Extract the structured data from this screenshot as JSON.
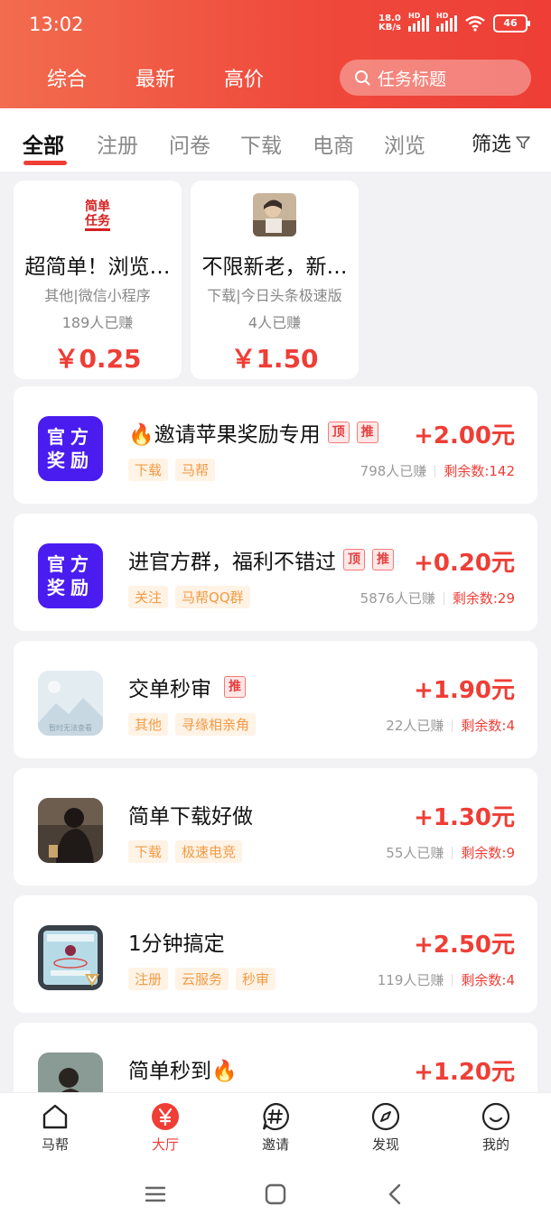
{
  "status": {
    "time": "13:02",
    "net_speed_top": "18.0",
    "net_speed_bottom": "KB/s",
    "hd": "HD",
    "battery": "46"
  },
  "header": {
    "tabs": [
      "综合",
      "最新",
      "高价"
    ],
    "search_placeholder": "任务标题"
  },
  "categories": {
    "items": [
      "全部",
      "注册",
      "问卷",
      "下载",
      "电商",
      "浏览"
    ],
    "active": "全部",
    "filter_label": "筛选"
  },
  "featured": [
    {
      "title": "超简单！浏览…",
      "subtitle": "其他|微信小程序",
      "earned": "189人已赚",
      "price": "￥0.25",
      "thumb_text": [
        "简单",
        "任务"
      ]
    },
    {
      "title": "不限新老，新…",
      "subtitle": "下载|今日头条极速版",
      "earned": "4人已赚",
      "price": "￥1.50"
    }
  ],
  "tasks": [
    {
      "thumb": "official",
      "thumb_text": [
        "官方",
        "奖励"
      ],
      "title": "🔥邀请苹果奖励专用",
      "badges": [
        "顶",
        "推"
      ],
      "tags": [
        "下载",
        "马帮"
      ],
      "price": "+2.00元",
      "earned": "798人已赚",
      "remaining": "剩余数:142"
    },
    {
      "thumb": "official",
      "thumb_text": [
        "官方",
        "奖励"
      ],
      "title": "进官方群，福利不错过",
      "badges": [
        "顶",
        "推"
      ],
      "tags": [
        "关注",
        "马帮QQ群"
      ],
      "price": "+0.20元",
      "earned": "5876人已赚",
      "remaining": "剩余数:29"
    },
    {
      "thumb": "placeholder",
      "thumb_caption": "暂时无法查看",
      "title": "交单秒审",
      "badges": [
        "推"
      ],
      "tags": [
        "其他",
        "寻缘相亲角"
      ],
      "price": "+1.90元",
      "earned": "22人已赚",
      "remaining": "剩余数:4"
    },
    {
      "thumb": "photo",
      "title": "简单下载好做",
      "badges": [],
      "tags": [
        "下载",
        "极速电竞"
      ],
      "price": "+1.30元",
      "earned": "55人已赚",
      "remaining": "剩余数:9"
    },
    {
      "thumb": "screen",
      "title": "1分钟搞定",
      "badges": [],
      "tags": [
        "注册",
        "云服务",
        "秒审"
      ],
      "price": "+2.50元",
      "earned": "119人已赚",
      "remaining": "剩余数:4"
    },
    {
      "thumb": "photo2",
      "title": "简单秒到🔥",
      "badges": [],
      "tags": [],
      "price": "+1.20元",
      "earned": "",
      "remaining": ""
    }
  ],
  "bottom_nav": {
    "items": [
      {
        "label": "马帮",
        "icon": "home-icon"
      },
      {
        "label": "大厅",
        "icon": "yen-icon"
      },
      {
        "label": "邀请",
        "icon": "hashtag-icon"
      },
      {
        "label": "发现",
        "icon": "compass-icon"
      },
      {
        "label": "我的",
        "icon": "smile-icon"
      }
    ],
    "active": "大厅"
  },
  "colors": {
    "accent": "#ee3e36",
    "header_start": "#f26c4f",
    "official_bg": "#4b1cf0",
    "tag_text": "#f29b45",
    "tag_bg": "#fff3e6"
  }
}
